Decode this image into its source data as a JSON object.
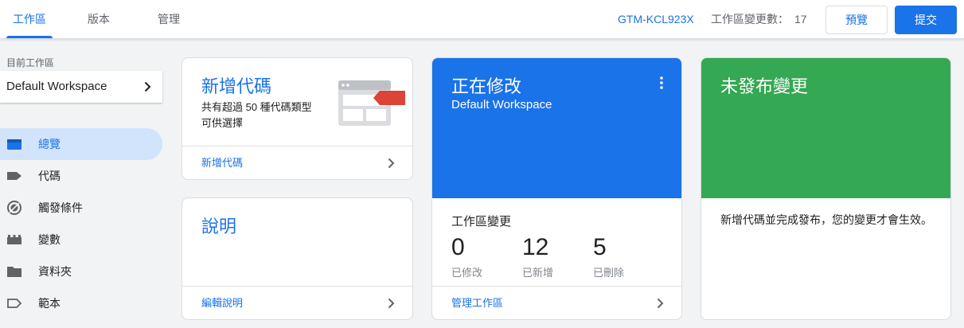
{
  "topbar": {
    "tabs": [
      {
        "label": "工作區",
        "active": true
      },
      {
        "label": "版本",
        "active": false
      },
      {
        "label": "管理",
        "active": false
      }
    ],
    "container_id": "GTM-KCL923X",
    "changes_label": "工作區變更數：",
    "changes_count": "17",
    "preview_label": "預覽",
    "submit_label": "提交"
  },
  "sidebar": {
    "caption": "目前工作區",
    "workspace_name": "Default Workspace",
    "items": [
      {
        "label": "總覽",
        "icon": "overview-icon",
        "active": true
      },
      {
        "label": "代碼",
        "icon": "tag-icon",
        "active": false
      },
      {
        "label": "觸發條件",
        "icon": "trigger-icon",
        "active": false
      },
      {
        "label": "變數",
        "icon": "variable-icon",
        "active": false
      },
      {
        "label": "資料夾",
        "icon": "folder-icon",
        "active": false
      },
      {
        "label": "範本",
        "icon": "template-icon",
        "active": false
      }
    ]
  },
  "cards": {
    "add_tag": {
      "title": "新增代碼",
      "description": "共有超過 50 種代碼類型可供選擇",
      "link": "新增代碼"
    },
    "help": {
      "title": "說明",
      "link": "編輯說明"
    },
    "editing": {
      "title": "正在修改",
      "workspace": "Default Workspace",
      "section_label": "工作區變更",
      "stats": [
        {
          "value": "0",
          "label": "已修改"
        },
        {
          "value": "12",
          "label": "已新增"
        },
        {
          "value": "5",
          "label": "已刪除"
        }
      ],
      "link": "管理工作區"
    },
    "unpublished": {
      "title": "未發布變更",
      "message": "新增代碼並完成發布，您的變更才會生效。"
    }
  },
  "colors": {
    "accent": "#1a73e8",
    "green": "#34a853",
    "active_nav_bg": "#d2e3fc",
    "tag_red": "#db4437"
  }
}
